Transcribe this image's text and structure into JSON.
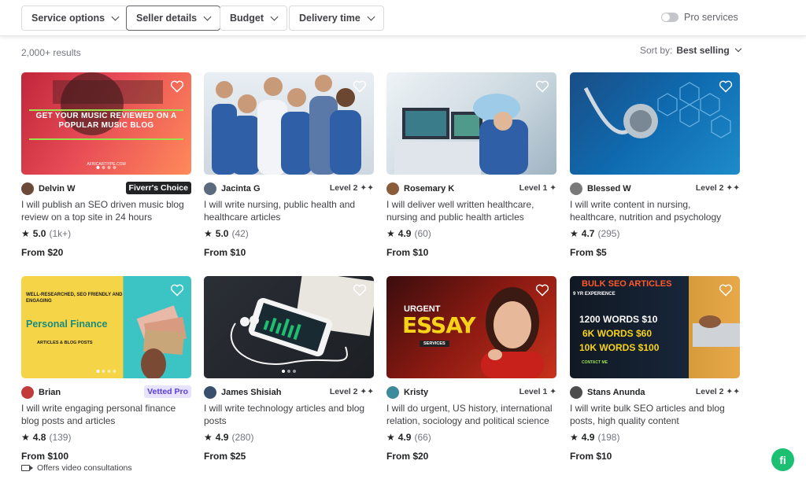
{
  "filters": {
    "service_options": "Service options",
    "seller_details": "Seller details",
    "budget": "Budget",
    "delivery_time": "Delivery time",
    "pro_services": "Pro services"
  },
  "results_count": "2,000+ results",
  "sort": {
    "label": "Sort by:",
    "value": "Best selling"
  },
  "gigs": [
    {
      "seller": "Delvin W",
      "badge": "Fiverr's Choice",
      "title": "I will publish an SEO driven music blog review on a top site in 24 hours",
      "rating": "5.0",
      "reviews": "(1k+)",
      "price": "From $20",
      "thumb_text": "GET YOUR MUSIC REVIEWED ON A POPULAR MUSIC BLOG",
      "thumb_sub": "AFRICARTIYPE.COM",
      "avatar_color": "#6b4a3a"
    },
    {
      "seller": "Jacinta G",
      "level": "Level 2 ✦✦",
      "title": "I will write nursing, public health and healthcare articles",
      "rating": "5.0",
      "reviews": "(42)",
      "price": "From $10",
      "avatar_color": "#5a6b7d"
    },
    {
      "seller": "Rosemary K",
      "level": "Level 1 ✦",
      "title": "I will deliver well written healthcare, nursing and public health articles",
      "rating": "4.9",
      "reviews": "(60)",
      "price": "From $10",
      "avatar_color": "#8a5c3a"
    },
    {
      "seller": "Blessed W",
      "level": "Level 2 ✦✦",
      "title": "I will write content in nursing, healthcare, nutrition and psychology",
      "rating": "4.7",
      "reviews": "(295)",
      "price": "From $5",
      "avatar_color": "#7a7a7a"
    },
    {
      "seller": "Brian",
      "badge": "Vetted Pro",
      "title": "I will write engaging personal finance blog posts and articles",
      "rating": "4.8",
      "reviews": "(139)",
      "price": "From $100",
      "thumb_top": "WELL-RESEARCHED, SEO FRIENDLY AND ENGAGING",
      "thumb_main": "Personal Finance",
      "thumb_sub": "ARTICLES & BLOG POSTS",
      "avatar_color": "#c23a3a"
    },
    {
      "seller": "James Shisiah",
      "level": "Level 2 ✦✦",
      "title": "I will write technology articles and blog posts",
      "rating": "4.9",
      "reviews": "(280)",
      "price": "From $25",
      "avatar_color": "#3a4f6b"
    },
    {
      "seller": "Kristy",
      "level": "Level 1 ✦",
      "title": "I will do urgent, US history, international relation, sociology and political science",
      "rating": "4.9",
      "reviews": "(66)",
      "price": "From $20",
      "thumb_top": "URGENT",
      "thumb_main": "ESSAY",
      "thumb_sub": "SERVICES",
      "avatar_color": "#3c8a9a"
    },
    {
      "seller": "Stans Anunda",
      "level": "Level 2 ✦✦",
      "title": "I will write bulk SEO articles and blog posts, high quality content",
      "rating": "4.9",
      "reviews": "(198)",
      "price": "From $10",
      "thumb_top": "BULK SEO ARTICLES",
      "thumb_exp": "9 YR EXPERIENCE",
      "thumb_lines": [
        "1200 WORDS $10",
        "6K WORDS $60",
        "10K WORDS $100"
      ],
      "thumb_contact": "CONTACT ME",
      "avatar_color": "#4d4d4d"
    }
  ],
  "video_note": "Offers video consultations",
  "fab": "fi",
  "colors": {
    "brand_green": "#1dbf73",
    "choice_bg": "#222325",
    "choice_accent": "#1dbf73",
    "vetted_bg": "#e7e3ff",
    "vetted_text": "#5b3fd6"
  }
}
